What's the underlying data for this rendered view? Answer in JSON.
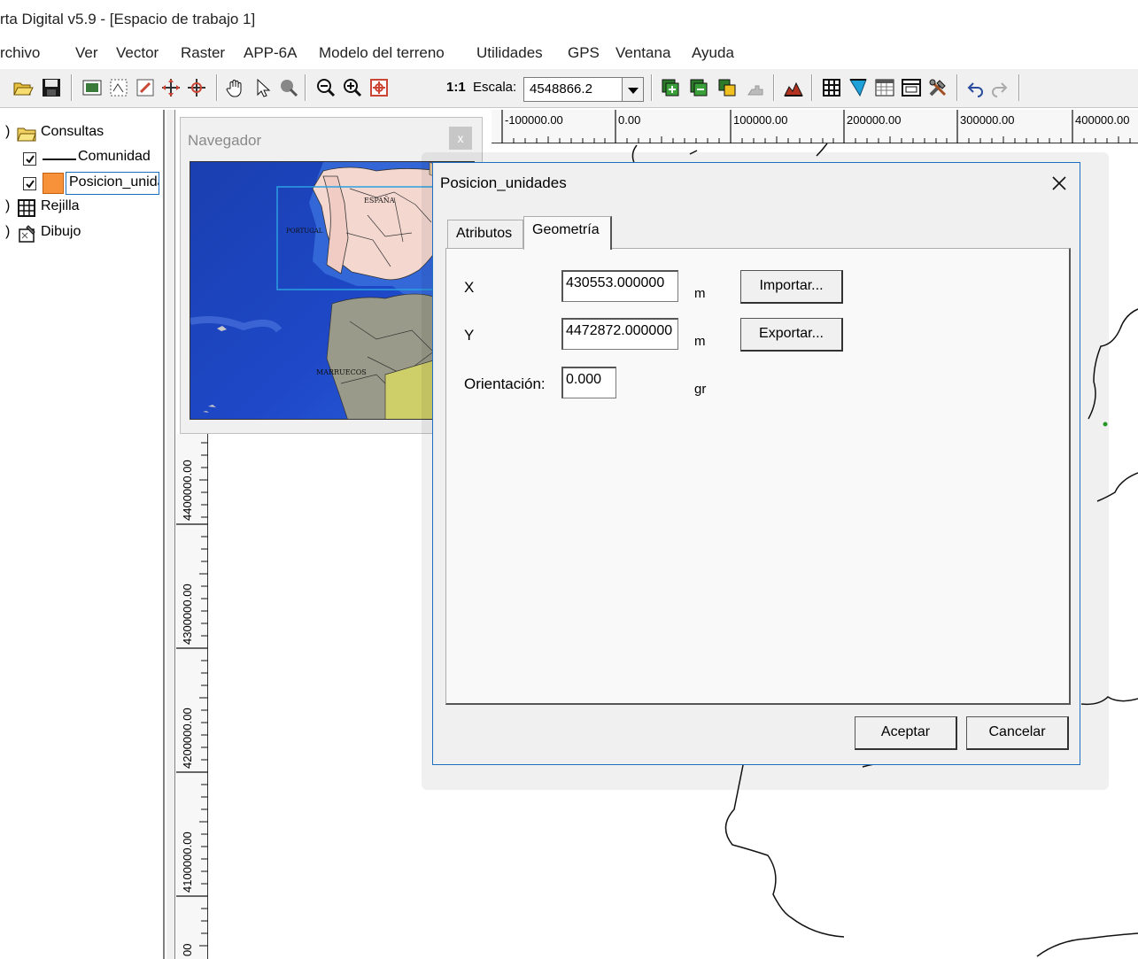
{
  "window": {
    "title": "rta Digital v5.9 - [Espacio de trabajo 1]"
  },
  "menu": [
    "rchivo",
    "Ver",
    "Vector",
    "Raster",
    "APP-6A",
    "Modelo del terreno",
    "Utilidades",
    "GPS",
    "Ventana",
    "Ayuda"
  ],
  "toolbar": {
    "scale_prefix": "1:1",
    "scale_label": "Escala:",
    "scale_value": "4548866.2"
  },
  "layers": {
    "consultas": "Consultas",
    "comunidad": "Comunidad",
    "posicion": "Posicion_unida",
    "rejilla": "Rejilla",
    "dibujo": "Dibujo"
  },
  "ruler": {
    "top": [
      "-100000.00",
      "0.00",
      "100000.00",
      "200000.00",
      "300000.00",
      "400000.00"
    ],
    "left": [
      "4400000.00",
      "4300000.00",
      "4200000.00",
      "4100000.00",
      "00"
    ]
  },
  "navigator": {
    "title": "Navegador",
    "close": "x",
    "labels": [
      "ESPAÑA",
      "PORTUGAL",
      "MARRUECOS"
    ]
  },
  "dialog": {
    "title": "Posicion_unidades",
    "tabs": [
      "Atributos",
      "Geometría"
    ],
    "active_tab": "Geometría",
    "x_label": "X",
    "x_value": "430553.000000",
    "y_label": "Y",
    "y_value": "4472872.000000",
    "orient_label": "Orientación:",
    "orient_value": "0.000",
    "unit_m": "m",
    "unit_gr": "gr",
    "import_btn": "Importar...",
    "export_btn": "Exportar...",
    "accept_btn": "Aceptar",
    "cancel_btn": "Cancelar"
  }
}
